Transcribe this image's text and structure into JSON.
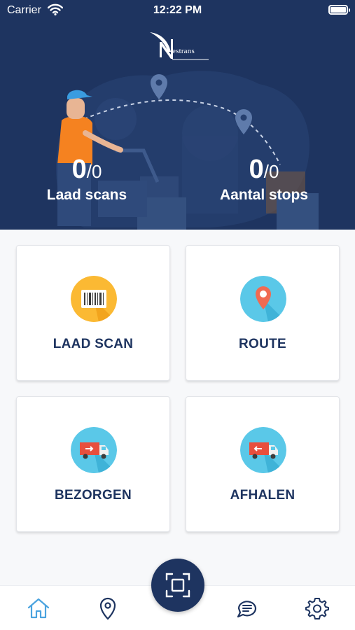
{
  "status_bar": {
    "carrier": "Carrier",
    "time": "12:22 PM"
  },
  "brand": {
    "logo_text": "estrans",
    "colors": {
      "primary": "#1e3460",
      "accent_orange": "#f58220",
      "icon_bg": "#5ac8e8",
      "icon_bg_scan": "#fbb933"
    }
  },
  "stats": {
    "load_scans": {
      "value": "0",
      "total": "/0",
      "label": "Laad scans"
    },
    "stops": {
      "value": "0",
      "total": "/0",
      "label": "Aantal stops"
    }
  },
  "tiles": [
    {
      "label": "LAAD SCAN",
      "icon": "barcode-icon"
    },
    {
      "label": "ROUTE",
      "icon": "location-pin-icon"
    },
    {
      "label": "BEZORGEN",
      "icon": "delivery-truck-icon"
    },
    {
      "label": "AFHALEN",
      "icon": "pickup-truck-icon"
    }
  ],
  "bottom_nav": {
    "items": [
      "home-icon",
      "map-pin-icon",
      "scan-icon",
      "chat-icon",
      "settings-icon"
    ]
  }
}
